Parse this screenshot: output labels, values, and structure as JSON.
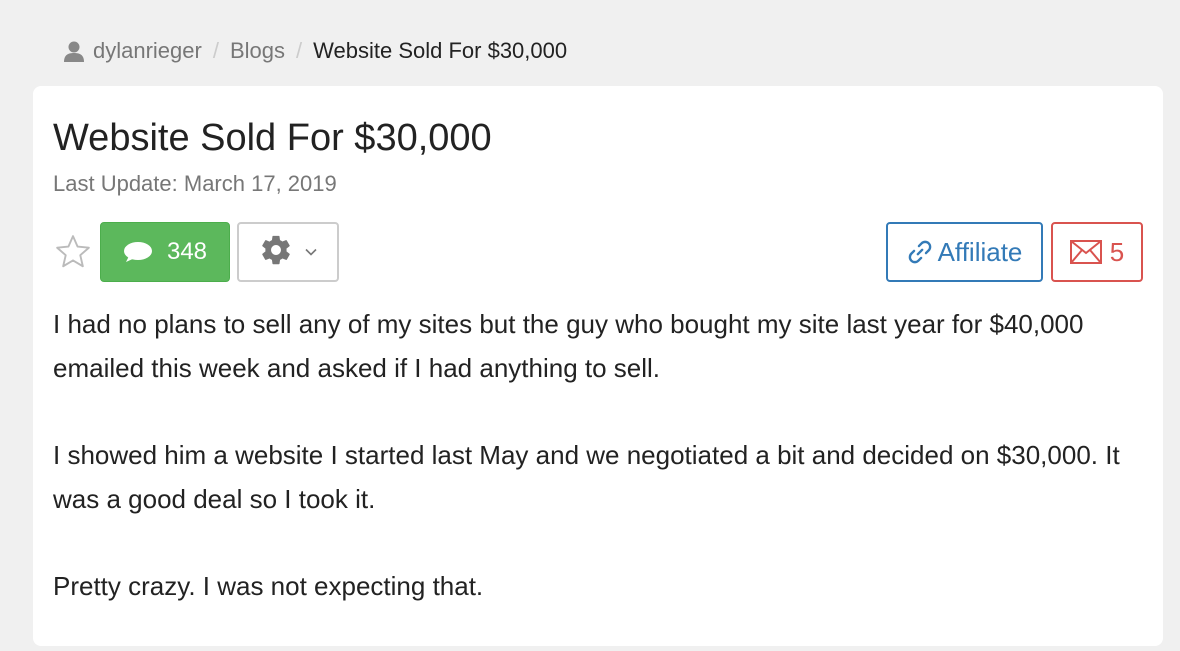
{
  "breadcrumb": {
    "user": "dylanrieger",
    "section": "Blogs",
    "current": "Website Sold For $30,000",
    "separator": "/"
  },
  "post": {
    "title": "Website Sold For $30,000",
    "last_update": "Last Update: March 17, 2019",
    "paragraphs": [
      "I had no plans to sell any of my sites but the guy who bought my site last year for $40,000 emailed this week and asked if I had anything to sell.",
      "I showed him a website I started last May and we negotiated a bit and decided on $30,000. It was a good deal so I took it.",
      "Pretty crazy. I was not expecting that."
    ]
  },
  "toolbar": {
    "comment_count": "348",
    "affiliate_label": "Affiliate",
    "message_count": "5"
  },
  "icons": {
    "user": "user-icon",
    "star": "star-icon",
    "comment": "comment-bubble-icon",
    "settings": "gear-icon",
    "caret": "chevron-down-icon",
    "link": "link-icon",
    "mail": "envelope-icon"
  },
  "colors": {
    "success": "#5cb85c",
    "primary": "#337ab7",
    "danger": "#d9534f",
    "muted": "#777777"
  }
}
